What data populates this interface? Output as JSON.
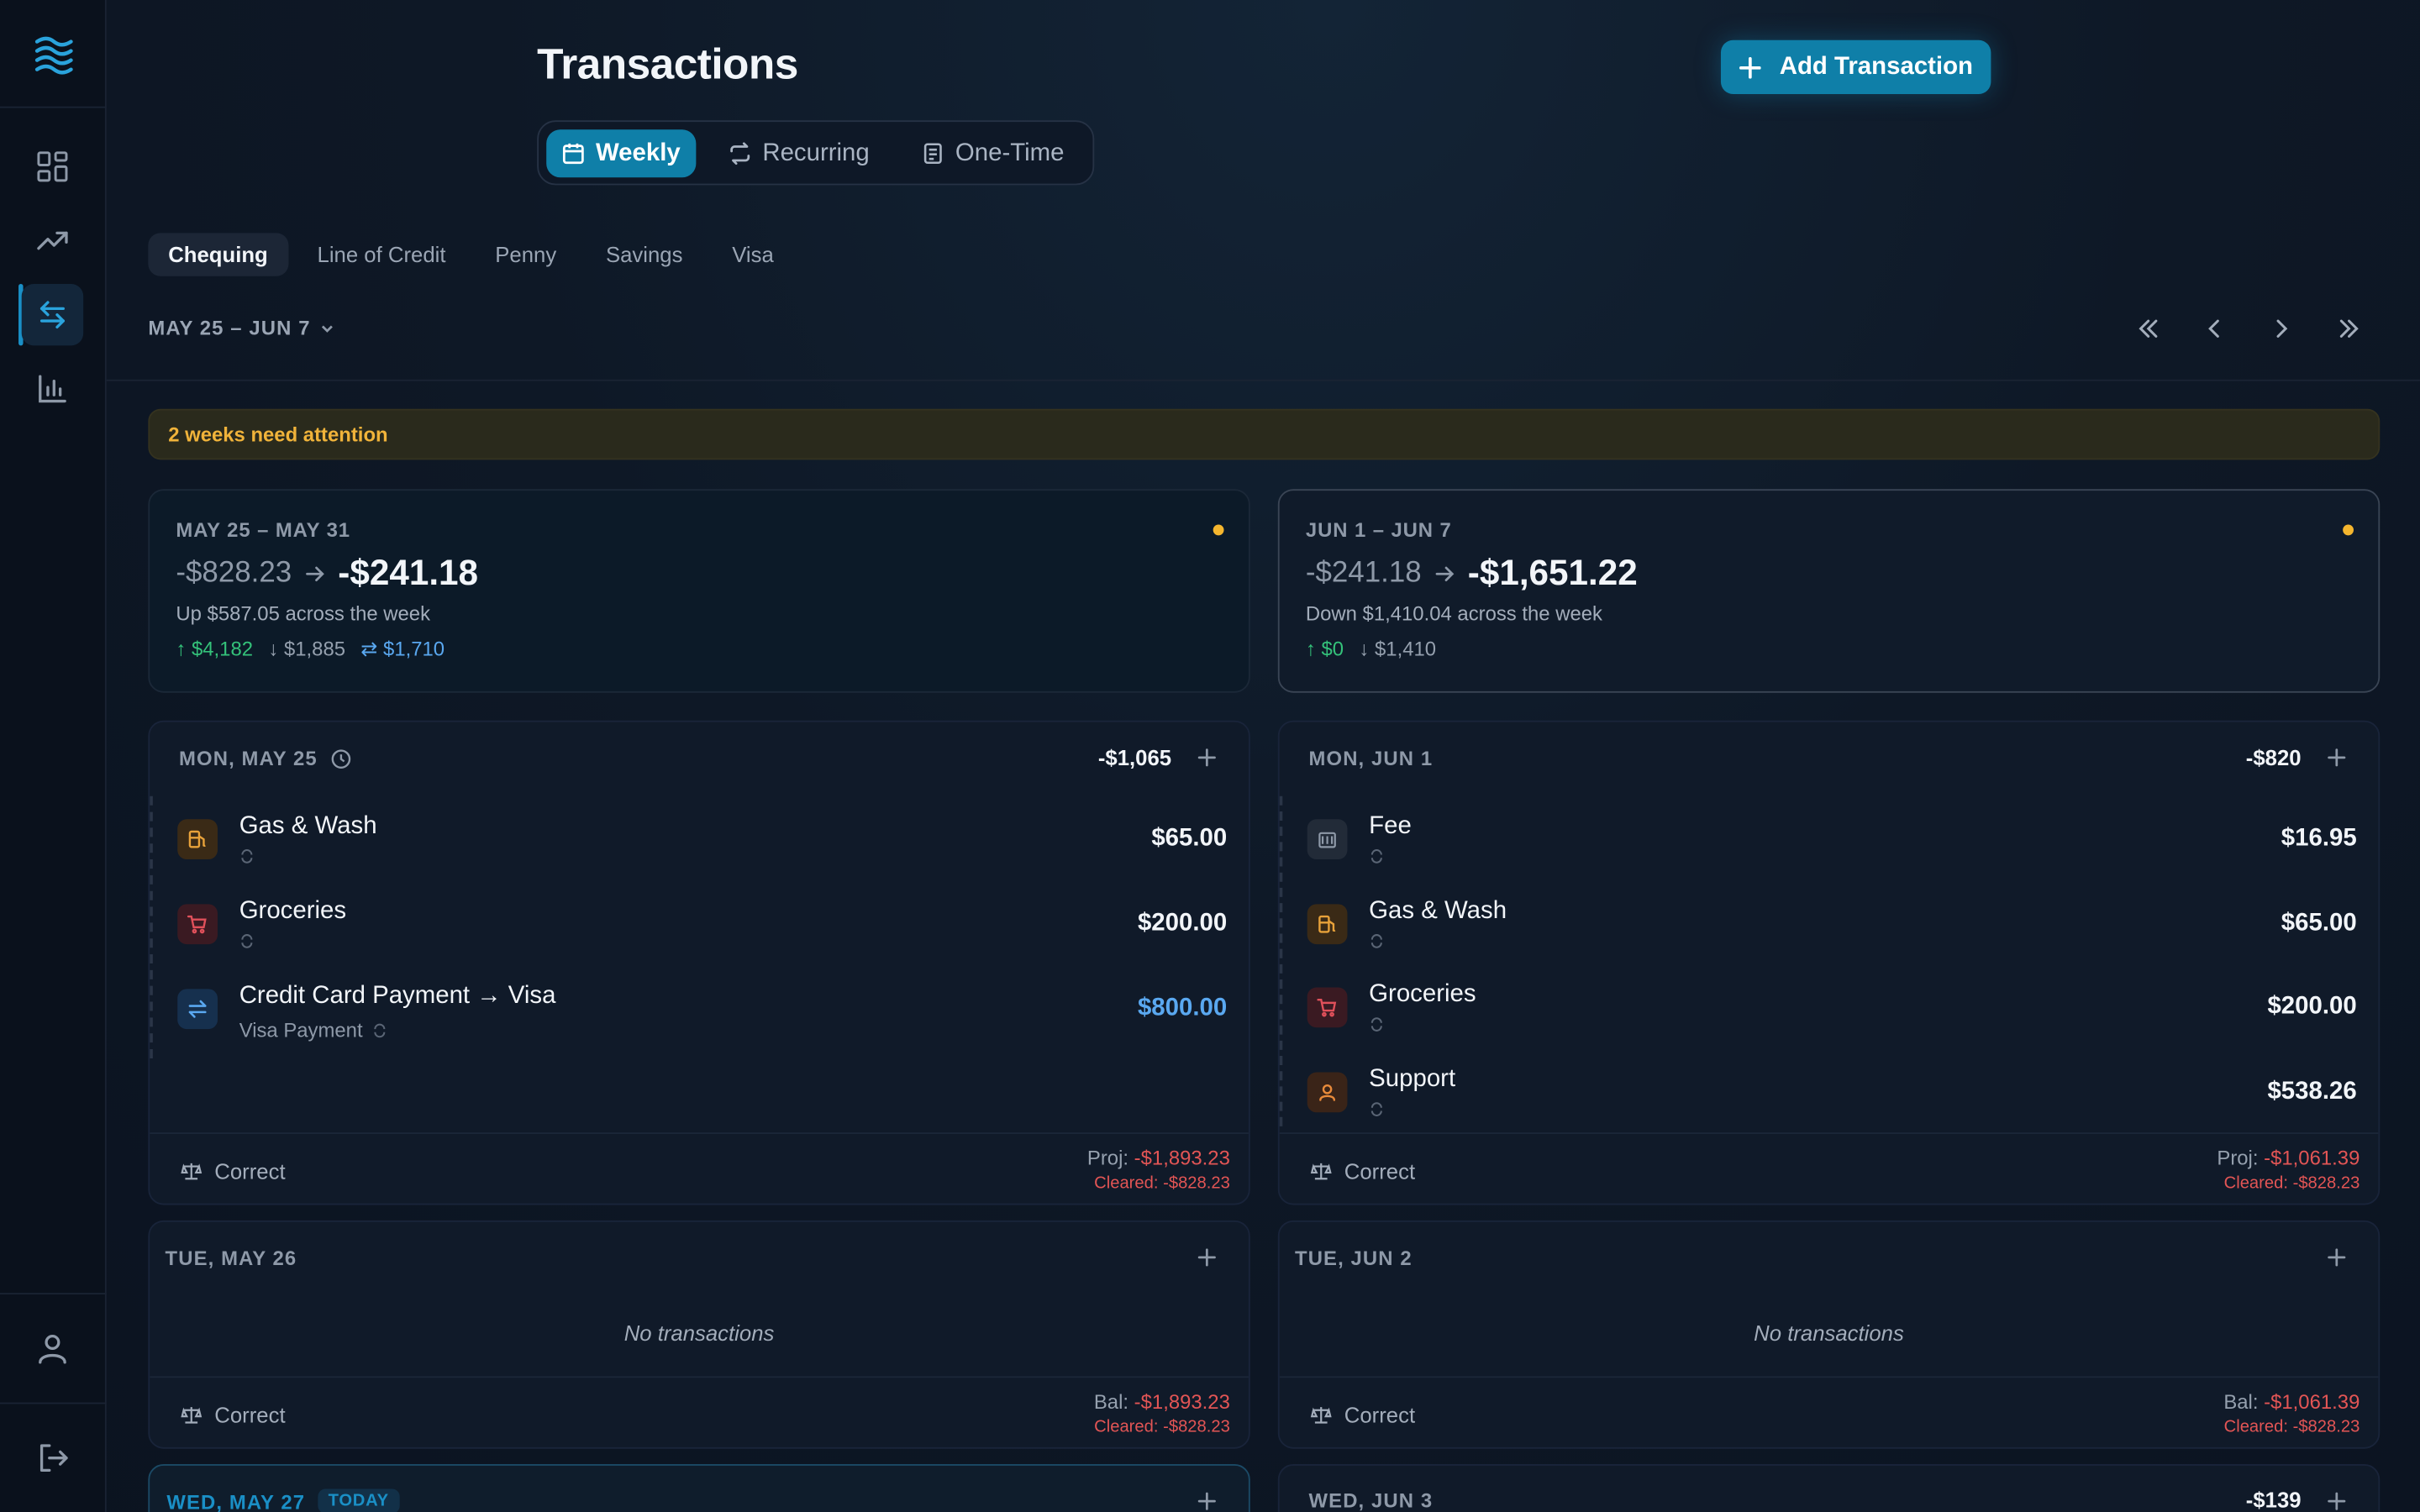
{
  "header": {
    "title": "Transactions",
    "add_button": "Add Transaction"
  },
  "view_tabs": [
    {
      "label": "Weekly",
      "icon": "calendar-icon",
      "active": true
    },
    {
      "label": "Recurring",
      "icon": "repeat-icon",
      "active": false
    },
    {
      "label": "One-Time",
      "icon": "receipt-icon",
      "active": false
    }
  ],
  "accounts": [
    "Chequing",
    "Line of Credit",
    "Penny",
    "Savings",
    "Visa"
  ],
  "active_account": "Chequing",
  "range_label": "MAY 25 – JUN 7",
  "attention": "2 weeks need attention",
  "weeks": [
    {
      "range": "MAY 25 – MAY 31",
      "from": "-$828.23",
      "to": "-$241.18",
      "summary": "Up $587.05 across the week",
      "inflow": "$4,182",
      "outflow": "$1,885",
      "transfer": "$1,710"
    },
    {
      "range": "JUN 1 – JUN 7",
      "from": "-$241.18",
      "to": "-$1,651.22",
      "summary": "Down $1,410.04 across the week",
      "inflow": "$0",
      "outflow": "$1,410"
    }
  ],
  "days": {
    "mon_may25": {
      "label": "MON, MAY 25",
      "total": "-$1,065",
      "txns": [
        {
          "name": "Gas & Wash",
          "amount": "$65.00",
          "icon": "fuel-icon"
        },
        {
          "name": "Groceries",
          "amount": "$200.00",
          "icon": "cart-icon"
        },
        {
          "name": "Credit Card Payment → Visa",
          "sub": "Visa Payment",
          "amount": "$800.00",
          "icon": "transfer-icon"
        }
      ],
      "correct": "Correct",
      "foot_label": "Proj:",
      "foot_value": "-$1,893.23",
      "cleared": "Cleared: -$828.23"
    },
    "mon_jun1": {
      "label": "MON, JUN 1",
      "total": "-$820",
      "txns": [
        {
          "name": "Fee",
          "amount": "$16.95",
          "icon": "bank-icon"
        },
        {
          "name": "Gas & Wash",
          "amount": "$65.00",
          "icon": "fuel-icon"
        },
        {
          "name": "Groceries",
          "amount": "$200.00",
          "icon": "cart-icon"
        },
        {
          "name": "Support",
          "amount": "$538.26",
          "icon": "person-icon"
        }
      ],
      "correct": "Correct",
      "foot_label": "Proj:",
      "foot_value": "-$1,061.39",
      "cleared": "Cleared: -$828.23"
    },
    "tue_may26": {
      "label": "TUE, MAY 26",
      "empty": "No transactions",
      "correct": "Correct",
      "foot_label": "Bal:",
      "foot_value": "-$1,893.23",
      "cleared": "Cleared: -$828.23"
    },
    "tue_jun2": {
      "label": "TUE, JUN 2",
      "empty": "No transactions",
      "correct": "Correct",
      "foot_label": "Bal:",
      "foot_value": "-$1,061.39",
      "cleared": "Cleared: -$828.23"
    },
    "wed_may27": {
      "label": "WED, MAY 27",
      "badge": "TODAY"
    },
    "wed_jun3": {
      "label": "WED, JUN 3",
      "total": "-$139"
    }
  },
  "colors": {
    "accent": "#0f7fa8",
    "positive": "#34c27a",
    "negative": "#e25555",
    "transfer": "#5aa8f0",
    "warning": "#f0b33a"
  }
}
